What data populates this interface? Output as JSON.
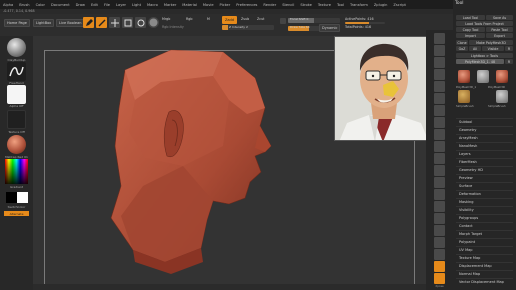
{
  "menu": [
    "Alpha",
    "Brush",
    "Color",
    "Document",
    "Draw",
    "Edit",
    "File",
    "Layer",
    "Light",
    "Macro",
    "Marker",
    "Material",
    "Movie",
    "Picker",
    "Preferences",
    "Render",
    "Stencil",
    "Stroke",
    "Texture",
    "Tool",
    "Transform",
    "Zplugin",
    "Zscript"
  ],
  "coords": "-0.477, 0.14, 0.968",
  "toolbar": {
    "home_page": "Home Page",
    "lightbox": "LightBox",
    "live_boolean": "Live Boolean",
    "edit": "Edit",
    "draw": "Draw",
    "move": "Move",
    "scale": "Scale",
    "rotate": "Rotate",
    "mrgb": "Mrgb",
    "rgb": "Rgb",
    "m": "M",
    "rgb_intensity": "Rgb Intensity",
    "zadd": "Zadd",
    "zsub": "Zsub",
    "zcut": "Zcut",
    "z_intensity": "Z Intensity 2",
    "z_intensity_level": 0.12,
    "focal_shift": "Focal Shift 0",
    "focal_shift_level": 0.5,
    "draw_size": "Draw Size 64",
    "draw_size_level": 0.4,
    "dynamic": "Dynamic",
    "active_points": "ActivePoints: 416",
    "total_points": "TotalPoints: 416",
    "total_points_level": 0.6
  },
  "left_panel": {
    "brush_label": "ClayBuildup",
    "stroke_label": "FreeHand",
    "alpha_label": "Alpha Off",
    "texture_label": "Texture Off",
    "material_label": "MatCap Red 01",
    "gradient_label": "Gradient",
    "switch_label": "SwitchColor",
    "alternate_label": "Alternate"
  },
  "right_strip": [
    "BPR",
    "SPix 3",
    "Scroll",
    "Zoom",
    "Actual",
    "AAHalf",
    "Persp",
    "Floor",
    "Local",
    "L.Sym",
    "Xyz",
    "Frame",
    "Move",
    "Scale",
    "Rotate",
    "Line Fill",
    "PolyF",
    "Transp",
    "Ghost",
    "Solo",
    "Xpose"
  ],
  "tool_panel": {
    "title": "Tool",
    "load_tool": "Load Tool",
    "save_as": "Save As",
    "load_from_project": "Load Tools From Project",
    "copy_tool": "Copy Tool",
    "paste_tool": "Paste Tool",
    "import": "Import",
    "export": "Export",
    "clone": "Clone",
    "make_polymesh": "Make PolyMesh3D",
    "goz": "GoZ",
    "all": "All",
    "visible": "Visible",
    "r": "R",
    "lightbox_tools": "Lightbox > Tools",
    "current_tool": "PolyMesh3D_1. 48",
    "r2": "R",
    "tool_items": [
      "PolyMesh3D_1",
      "SimpleBrush",
      "PolyMesh3D",
      "SimpleBrush"
    ],
    "subpalettes": [
      "Subtool",
      "Geometry",
      "ArrayMesh",
      "NanoMesh",
      "Layers",
      "FiberMesh",
      "Geometry HD",
      "Preview",
      "Surface",
      "Deformation",
      "Masking",
      "Visibility",
      "Polygroups",
      "Contact",
      "Morph Target",
      "Polypaint",
      "UV Map",
      "Texture Map",
      "Displacement Map",
      "Normal Map",
      "Vector Displacement Map"
    ]
  },
  "colors": {
    "accent_orange": "#e68a1a",
    "model_red": "#b0533c",
    "background": "#333333"
  }
}
